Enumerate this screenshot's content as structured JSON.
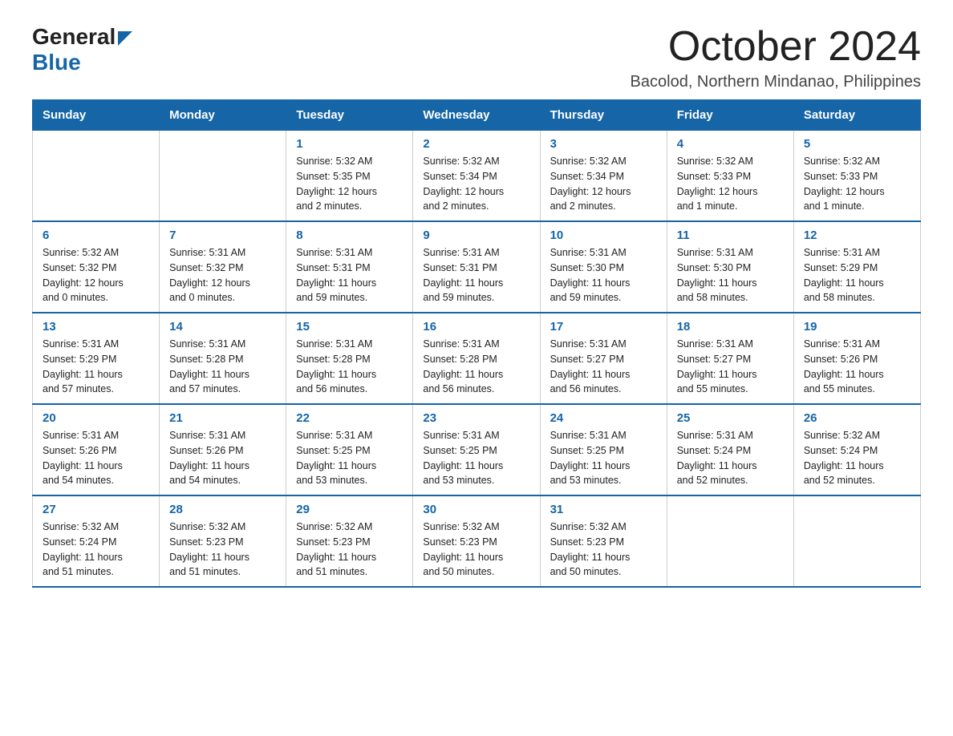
{
  "logo": {
    "general": "General",
    "blue": "Blue"
  },
  "title": "October 2024",
  "subtitle": "Bacolod, Northern Mindanao, Philippines",
  "days_of_week": [
    "Sunday",
    "Monday",
    "Tuesday",
    "Wednesday",
    "Thursday",
    "Friday",
    "Saturday"
  ],
  "weeks": [
    [
      {
        "day": "",
        "info": ""
      },
      {
        "day": "",
        "info": ""
      },
      {
        "day": "1",
        "info": "Sunrise: 5:32 AM\nSunset: 5:35 PM\nDaylight: 12 hours\nand 2 minutes."
      },
      {
        "day": "2",
        "info": "Sunrise: 5:32 AM\nSunset: 5:34 PM\nDaylight: 12 hours\nand 2 minutes."
      },
      {
        "day": "3",
        "info": "Sunrise: 5:32 AM\nSunset: 5:34 PM\nDaylight: 12 hours\nand 2 minutes."
      },
      {
        "day": "4",
        "info": "Sunrise: 5:32 AM\nSunset: 5:33 PM\nDaylight: 12 hours\nand 1 minute."
      },
      {
        "day": "5",
        "info": "Sunrise: 5:32 AM\nSunset: 5:33 PM\nDaylight: 12 hours\nand 1 minute."
      }
    ],
    [
      {
        "day": "6",
        "info": "Sunrise: 5:32 AM\nSunset: 5:32 PM\nDaylight: 12 hours\nand 0 minutes."
      },
      {
        "day": "7",
        "info": "Sunrise: 5:31 AM\nSunset: 5:32 PM\nDaylight: 12 hours\nand 0 minutes."
      },
      {
        "day": "8",
        "info": "Sunrise: 5:31 AM\nSunset: 5:31 PM\nDaylight: 11 hours\nand 59 minutes."
      },
      {
        "day": "9",
        "info": "Sunrise: 5:31 AM\nSunset: 5:31 PM\nDaylight: 11 hours\nand 59 minutes."
      },
      {
        "day": "10",
        "info": "Sunrise: 5:31 AM\nSunset: 5:30 PM\nDaylight: 11 hours\nand 59 minutes."
      },
      {
        "day": "11",
        "info": "Sunrise: 5:31 AM\nSunset: 5:30 PM\nDaylight: 11 hours\nand 58 minutes."
      },
      {
        "day": "12",
        "info": "Sunrise: 5:31 AM\nSunset: 5:29 PM\nDaylight: 11 hours\nand 58 minutes."
      }
    ],
    [
      {
        "day": "13",
        "info": "Sunrise: 5:31 AM\nSunset: 5:29 PM\nDaylight: 11 hours\nand 57 minutes."
      },
      {
        "day": "14",
        "info": "Sunrise: 5:31 AM\nSunset: 5:28 PM\nDaylight: 11 hours\nand 57 minutes."
      },
      {
        "day": "15",
        "info": "Sunrise: 5:31 AM\nSunset: 5:28 PM\nDaylight: 11 hours\nand 56 minutes."
      },
      {
        "day": "16",
        "info": "Sunrise: 5:31 AM\nSunset: 5:28 PM\nDaylight: 11 hours\nand 56 minutes."
      },
      {
        "day": "17",
        "info": "Sunrise: 5:31 AM\nSunset: 5:27 PM\nDaylight: 11 hours\nand 56 minutes."
      },
      {
        "day": "18",
        "info": "Sunrise: 5:31 AM\nSunset: 5:27 PM\nDaylight: 11 hours\nand 55 minutes."
      },
      {
        "day": "19",
        "info": "Sunrise: 5:31 AM\nSunset: 5:26 PM\nDaylight: 11 hours\nand 55 minutes."
      }
    ],
    [
      {
        "day": "20",
        "info": "Sunrise: 5:31 AM\nSunset: 5:26 PM\nDaylight: 11 hours\nand 54 minutes."
      },
      {
        "day": "21",
        "info": "Sunrise: 5:31 AM\nSunset: 5:26 PM\nDaylight: 11 hours\nand 54 minutes."
      },
      {
        "day": "22",
        "info": "Sunrise: 5:31 AM\nSunset: 5:25 PM\nDaylight: 11 hours\nand 53 minutes."
      },
      {
        "day": "23",
        "info": "Sunrise: 5:31 AM\nSunset: 5:25 PM\nDaylight: 11 hours\nand 53 minutes."
      },
      {
        "day": "24",
        "info": "Sunrise: 5:31 AM\nSunset: 5:25 PM\nDaylight: 11 hours\nand 53 minutes."
      },
      {
        "day": "25",
        "info": "Sunrise: 5:31 AM\nSunset: 5:24 PM\nDaylight: 11 hours\nand 52 minutes."
      },
      {
        "day": "26",
        "info": "Sunrise: 5:32 AM\nSunset: 5:24 PM\nDaylight: 11 hours\nand 52 minutes."
      }
    ],
    [
      {
        "day": "27",
        "info": "Sunrise: 5:32 AM\nSunset: 5:24 PM\nDaylight: 11 hours\nand 51 minutes."
      },
      {
        "day": "28",
        "info": "Sunrise: 5:32 AM\nSunset: 5:23 PM\nDaylight: 11 hours\nand 51 minutes."
      },
      {
        "day": "29",
        "info": "Sunrise: 5:32 AM\nSunset: 5:23 PM\nDaylight: 11 hours\nand 51 minutes."
      },
      {
        "day": "30",
        "info": "Sunrise: 5:32 AM\nSunset: 5:23 PM\nDaylight: 11 hours\nand 50 minutes."
      },
      {
        "day": "31",
        "info": "Sunrise: 5:32 AM\nSunset: 5:23 PM\nDaylight: 11 hours\nand 50 minutes."
      },
      {
        "day": "",
        "info": ""
      },
      {
        "day": "",
        "info": ""
      }
    ]
  ]
}
